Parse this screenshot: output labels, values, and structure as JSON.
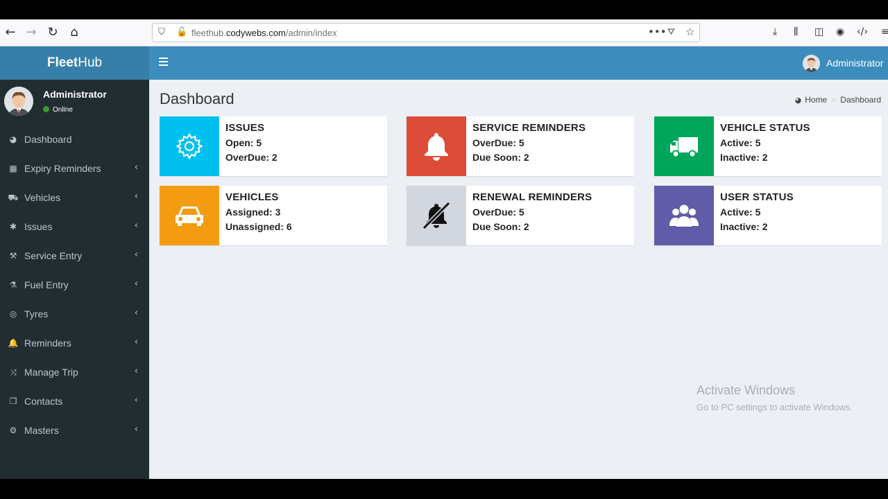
{
  "browser": {
    "url_prefix": "fleethub.",
    "url_domain": "codywebs.com",
    "url_path": "/admin/index"
  },
  "brand": {
    "bold": "Fleet",
    "light": "Hub"
  },
  "user": {
    "name": "Administrator",
    "status": "Online"
  },
  "menu": [
    {
      "label": "Dashboard",
      "icon": "dashboard-icon",
      "has_arrow": false
    },
    {
      "label": "Expiry Reminders",
      "icon": "calendar-icon",
      "has_arrow": true
    },
    {
      "label": "Vehicles",
      "icon": "truck-icon",
      "has_arrow": true
    },
    {
      "label": "Issues",
      "icon": "bug-icon",
      "has_arrow": true
    },
    {
      "label": "Service Entry",
      "icon": "wrench-icon",
      "has_arrow": true
    },
    {
      "label": "Fuel Entry",
      "icon": "flask-icon",
      "has_arrow": true
    },
    {
      "label": "Tyres",
      "icon": "life-ring-icon",
      "has_arrow": true
    },
    {
      "label": "Reminders",
      "icon": "bell-icon",
      "has_arrow": true
    },
    {
      "label": "Manage Trip",
      "icon": "random-icon",
      "has_arrow": true
    },
    {
      "label": "Contacts",
      "icon": "copy-icon",
      "has_arrow": true
    },
    {
      "label": "Masters",
      "icon": "gear-icon",
      "has_arrow": true
    }
  ],
  "topbar": {
    "user": "Administrator"
  },
  "page": {
    "title": "Dashboard",
    "breadcrumb": {
      "home": "Home",
      "sep": ">",
      "current": "Dashboard"
    }
  },
  "cards": [
    {
      "title": "ISSUES",
      "line1": "Open: 5",
      "line2": "OverDue: 2",
      "color": "#00c0ef",
      "icon": "gear-icon"
    },
    {
      "title": "SERVICE REMINDERS",
      "line1": "OverDue: 5",
      "line2": "Due Soon: 2",
      "color": "#dd4b39",
      "icon": "bell-icon"
    },
    {
      "title": "VEHICLE STATUS",
      "line1": "Active: 5",
      "line2": "Inactive: 2",
      "color": "#00a65a",
      "icon": "truck-icon"
    },
    {
      "title": "VEHICLES",
      "line1": "Assigned: 3",
      "line2": "Unassigned: 6",
      "color": "#f39c12",
      "icon": "car-icon"
    },
    {
      "title": "RENEWAL REMINDERS",
      "line1": "OverDue: 5",
      "line2": "Due Soon: 2",
      "color": "#d2d6de",
      "icon": "bell-slash-icon"
    },
    {
      "title": "USER STATUS",
      "line1": "Active: 5",
      "line2": "Inactive: 2",
      "color": "#605ca8",
      "icon": "users-icon"
    }
  ],
  "watermark": {
    "title": "Activate Windows",
    "subtitle": "Go to PC settings to activate Windows."
  }
}
